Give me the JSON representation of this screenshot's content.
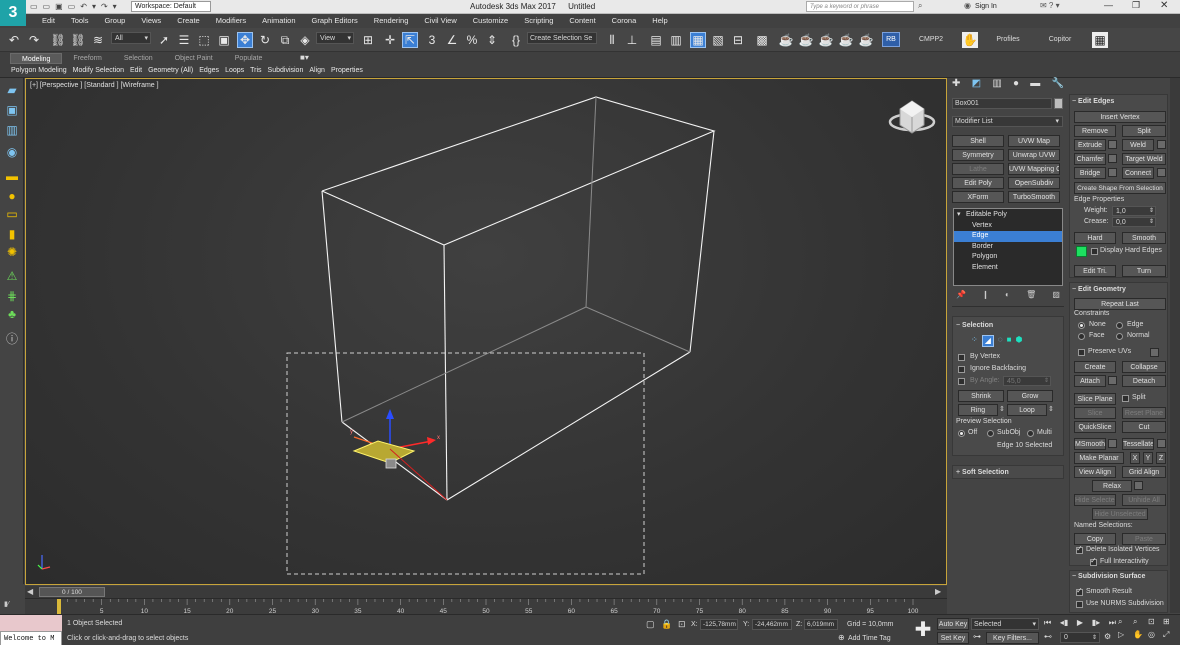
{
  "title_bar": {
    "app_title": "Autodesk 3ds Max 2017",
    "doc_title": "Untitled",
    "workspace": "Workspace: Default",
    "search_placeholder": "Type a keyword or phrase",
    "sign_in": "Sign In"
  },
  "menu": [
    "Edit",
    "Tools",
    "Group",
    "Views",
    "Create",
    "Modifiers",
    "Animation",
    "Graph Editors",
    "Rendering",
    "Civil View",
    "Customize",
    "Scripting",
    "Content",
    "Corona",
    "Help"
  ],
  "toolbar": {
    "filter": "All",
    "ref_coord": "View",
    "selection_set": "Create Selection Se",
    "rb": "RB",
    "cmpp2": "CMPP2",
    "profiles": "Profiles",
    "copitor": "Copitor"
  },
  "ribbon_tabs": [
    "Modeling",
    "Freeform",
    "Selection",
    "Object Paint",
    "Populate"
  ],
  "ribbon_panels": [
    "Polygon Modeling",
    "Modify Selection",
    "Edit",
    "Geometry (All)",
    "Edges",
    "Loops",
    "Tris",
    "Subdivision",
    "Align",
    "Properties"
  ],
  "viewport": {
    "label": "[+] [Perspective ] [Standard ] [Wireframe ]"
  },
  "command_panel": {
    "object_name": "Box001",
    "modifier_list": "Modifier List",
    "modifier_buttons": [
      [
        "Shell",
        "UVW Map"
      ],
      [
        "Symmetry",
        "Unwrap UVW"
      ],
      [
        "Lathe",
        "UVW Mapping Clear"
      ],
      [
        "Edit Poly",
        "OpenSubdiv"
      ],
      [
        "XForm",
        "TurboSmooth"
      ]
    ],
    "stack": [
      "Editable Poly",
      "Vertex",
      "Edge",
      "Border",
      "Polygon",
      "Element"
    ],
    "selection_header": "Selection",
    "by_vertex": "By Vertex",
    "ignore_backfacing": "Ignore Backfacing",
    "by_angle": "By Angle:",
    "by_angle_value": "45,0",
    "shrink": "Shrink",
    "grow": "Grow",
    "ring": "Ring",
    "loop": "Loop",
    "preview_selection": "Preview Selection",
    "preview_options": [
      "Off",
      "SubObj",
      "Multi"
    ],
    "selected_status": "Edge 10 Selected",
    "soft_selection": "Soft Selection"
  },
  "edit_edges": {
    "header": "Edit Edges",
    "insert_vertex": "Insert Vertex",
    "remove": "Remove",
    "split": "Split",
    "extrude": "Extrude",
    "weld": "Weld",
    "chamfer": "Chamfer",
    "target_weld": "Target Weld",
    "bridge": "Bridge",
    "connect": "Connect",
    "create_shape": "Create Shape From Selection",
    "edge_properties": "Edge Properties",
    "weight_label": "Weight:",
    "weight_value": "1,0",
    "crease_label": "Crease:",
    "crease_value": "0,0",
    "hard": "Hard",
    "smooth": "Smooth",
    "display_hard_edges": "Display Hard Edges",
    "edit_tri": "Edit Tri.",
    "turn": "Turn"
  },
  "edit_geometry": {
    "header": "Edit Geometry",
    "repeat_last": "Repeat Last",
    "constraints": "Constraints",
    "constraint_options": [
      "None",
      "Edge",
      "Face",
      "Normal"
    ],
    "preserve_uvs": "Preserve UVs",
    "create": "Create",
    "collapse": "Collapse",
    "attach": "Attach",
    "detach": "Detach",
    "slice_plane": "Slice Plane",
    "split": "Split",
    "slice": "Slice",
    "reset_plane": "Reset Plane",
    "quickslice": "QuickSlice",
    "cut": "Cut",
    "msmooth": "MSmooth",
    "tessellate": "Tessellate",
    "make_planar": "Make Planar",
    "axes": [
      "X",
      "Y",
      "Z"
    ],
    "view_align": "View Align",
    "grid_align": "Grid Align",
    "relax": "Relax",
    "hide_selected": "Hide Selected",
    "unhide_all": "Unhide All",
    "hide_unselected": "Hide Unselected",
    "named_selections": "Named Selections:",
    "copy": "Copy",
    "paste": "Paste",
    "delete_isolated": "Delete Isolated Vertices",
    "full_interactivity": "Full Interactivity"
  },
  "subdivision": {
    "header": "Subdivision Surface",
    "smooth_result": "Smooth Result",
    "use_nurms": "Use NURMS Subdivision"
  },
  "timeline": {
    "frame_display": "0 / 100",
    "ticks": [
      "0",
      "5",
      "10",
      "15",
      "20",
      "25",
      "30",
      "35",
      "40",
      "45",
      "50",
      "55",
      "60",
      "65",
      "70",
      "75",
      "80",
      "85",
      "90",
      "95",
      "100"
    ],
    "frame_current": 0,
    "frame_total": 100
  },
  "status_bar": {
    "maxscript": "Welcome to M",
    "selected": "1 Object Selected",
    "prompt": "Click or click-and-drag to select objects",
    "x_label": "X:",
    "x_value": "-125,78mm",
    "y_label": "Y:",
    "y_value": "-24,462mm",
    "z_label": "Z:",
    "z_value": "6,019mm",
    "grid": "Grid = 10,0mm",
    "add_time_tag": "Add Time Tag",
    "auto_key": "Auto Key",
    "set_key": "Set Key",
    "key_filter_dropdown": "Selected",
    "key_filters": "Key Filters...",
    "frame_field": "0"
  },
  "colors": {
    "accent_blue": "#3b7fd4",
    "edge_green": "#1de060",
    "viewport_bg": "#3a3a3a",
    "viewport_border": "#c7a43a"
  }
}
